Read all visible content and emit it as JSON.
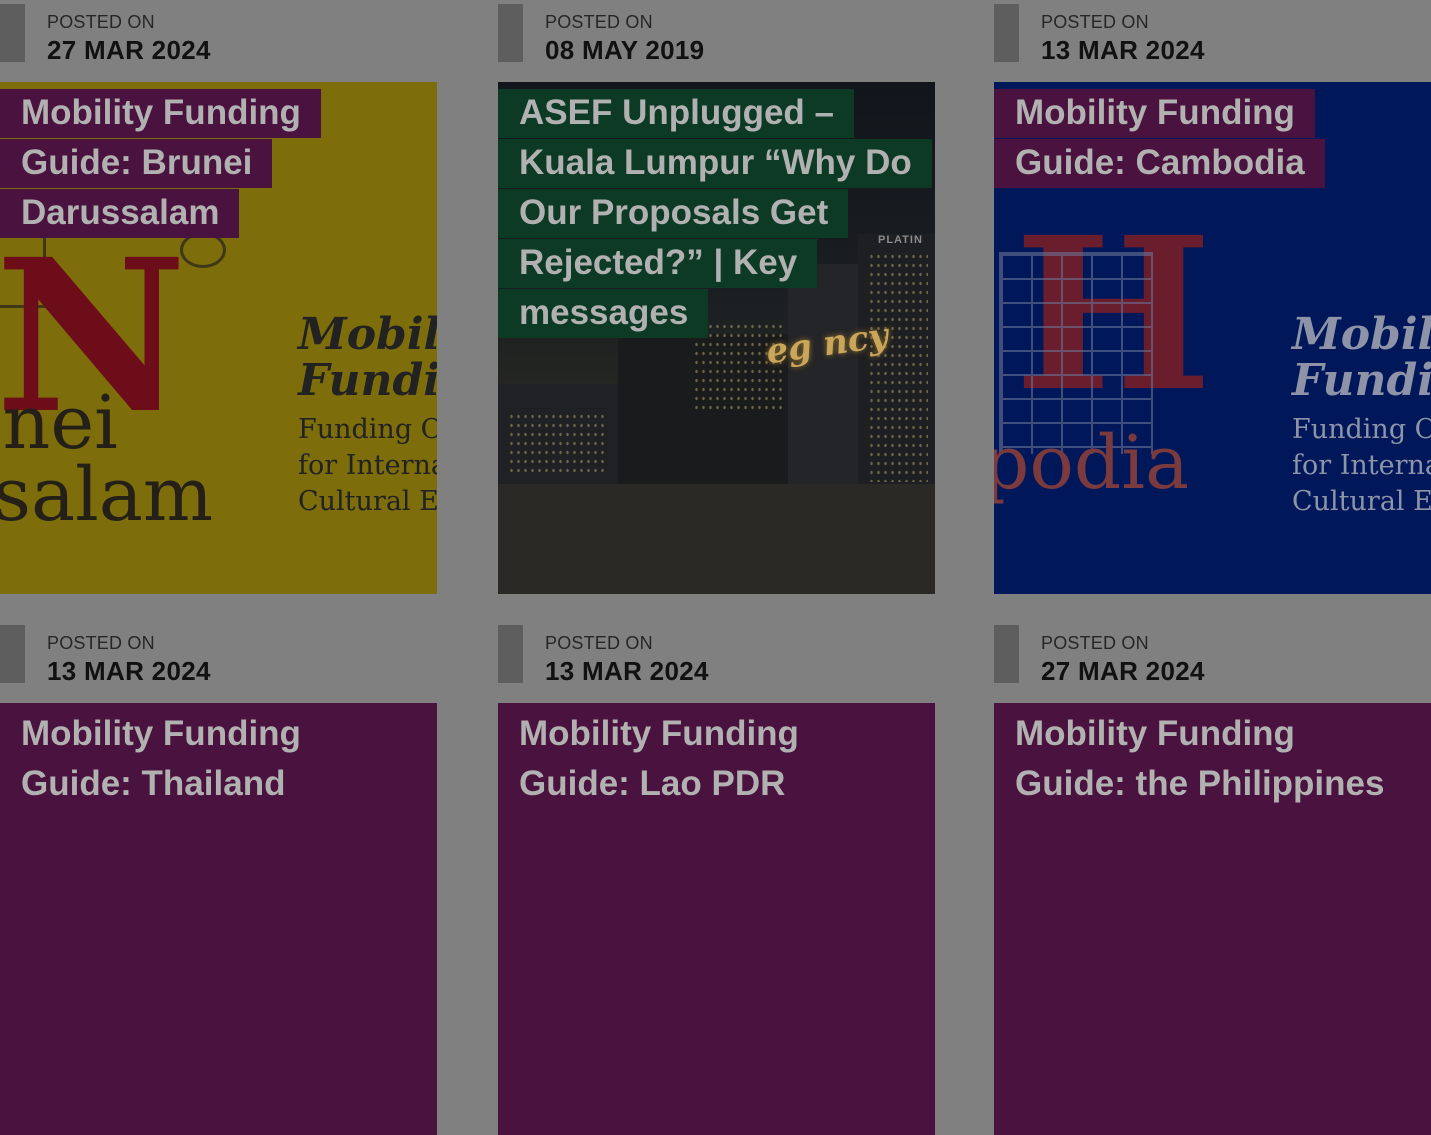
{
  "posted_label": "POSTED ON",
  "cards": [
    {
      "date": "27 MAR 2024",
      "title": "Mobility Funding Guide: Brunei Darussalam",
      "thumb": {
        "big_letter": "N",
        "name_lines": [
          "unei",
          "ssalam"
        ],
        "guide_lines": [
          "Mobili",
          "Fundi",
          "Funding Op",
          "for Internat",
          "Cultural Ex"
        ]
      }
    },
    {
      "date": "08 MAY 2019",
      "title": "ASEF Unplugged – Kuala Lumpur “Why Do Our Proposals Get Rejected?” | Key messages",
      "thumb": {
        "neon_text": "eg ncy",
        "sign_text": "PLATIN"
      }
    },
    {
      "date": "13 MAR 2024",
      "title": "Mobility Funding Guide: Cambodia",
      "thumb": {
        "big_letter": "H",
        "name_lines": [
          "podia"
        ],
        "guide_lines": [
          "Mobili",
          "Fundi",
          "Funding Op",
          "for Internat",
          "Cultural Ex"
        ]
      }
    },
    {
      "date": "13 MAR 2024",
      "title": "Mobility Funding Guide: Thailand"
    },
    {
      "date": "13 MAR 2024",
      "title": "Mobility Funding Guide: Lao PDR"
    },
    {
      "date": "27 MAR 2024",
      "title": "Mobility Funding Guide: the Philippines"
    }
  ],
  "colors": {
    "overlay_bg": "#808080",
    "card_purple": "#4a133f",
    "title_green": "#0d3a25",
    "brunei_yellow": "#7d6d0b",
    "cambodia_blue": "#00185a"
  }
}
